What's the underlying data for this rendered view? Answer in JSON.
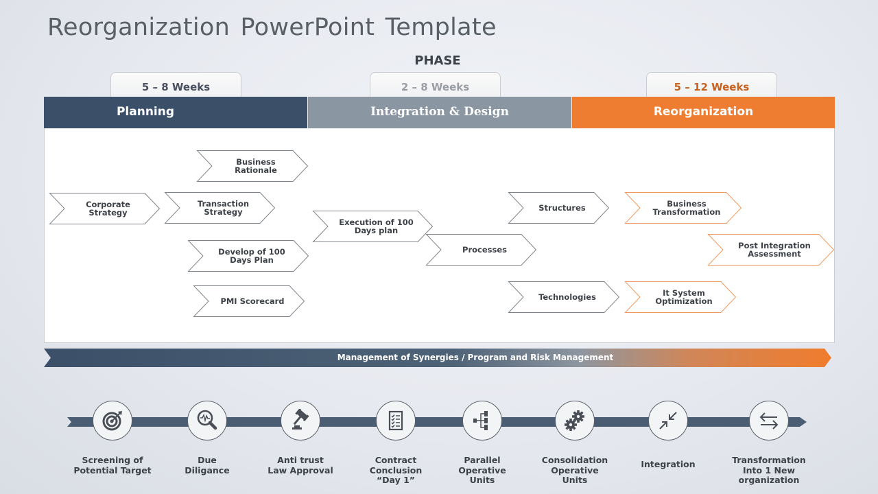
{
  "title": "Reorganization  PowerPoint  Template",
  "phase_heading": "PHASE",
  "colors": {
    "planning": "#3b5068",
    "integration": "#8a96a2",
    "reorganization": "#ee7d31",
    "chevron_gray_stroke": "#7f848a",
    "chevron_orange_stroke": "#ee9a5e"
  },
  "phases": [
    {
      "name": "Planning",
      "duration": "5 – 8 Weeks"
    },
    {
      "name": "Integration  &  Design",
      "duration": "2 – 8 Weeks"
    },
    {
      "name": "Reorganization",
      "duration": "5 – 12 Weeks"
    }
  ],
  "activities": [
    {
      "label": "Business\nRationale",
      "phase": "Planning"
    },
    {
      "label": "Corporate\nStrategy",
      "phase": "Planning"
    },
    {
      "label": "Transaction\nStrategy",
      "phase": "Planning"
    },
    {
      "label": "Develop of 100\nDays Plan",
      "phase": "Planning"
    },
    {
      "label": "PMI Scorecard",
      "phase": "Planning"
    },
    {
      "label": "Execution of 100\nDays plan",
      "phase": "Integration & Design"
    },
    {
      "label": "Processes",
      "phase": "Integration & Design"
    },
    {
      "label": "Structures",
      "phase": "Integration & Design"
    },
    {
      "label": "Technologies",
      "phase": "Integration & Design"
    },
    {
      "label": "Business\nTransformation",
      "phase": "Reorganization"
    },
    {
      "label": "Post Integration\nAssessment",
      "phase": "Reorganization"
    },
    {
      "label": "It System\nOptimization",
      "phase": "Reorganization"
    }
  ],
  "synergy_banner": "Management  of Synergies  /  Program  and  Risk  Management",
  "timeline": [
    {
      "label": "Screening of\nPotential  Target",
      "icon": "target-icon"
    },
    {
      "label": "Due\nDiligance",
      "icon": "magnifier-pulse-icon"
    },
    {
      "label": "Anti  trust\nLaw Approval",
      "icon": "gavel-icon"
    },
    {
      "label": "Contract\nConclusion\n“Day 1”",
      "icon": "checklist-icon"
    },
    {
      "label": "Parallel\nOperative\nUnits",
      "icon": "hierarchy-icon"
    },
    {
      "label": "Consolidation\nOperative\nUnits",
      "icon": "gears-icon"
    },
    {
      "label": "Integration",
      "icon": "arrows-inward-icon"
    },
    {
      "label": "Transformation\nInto  1 New\norganization",
      "icon": "swap-arrows-icon"
    }
  ]
}
